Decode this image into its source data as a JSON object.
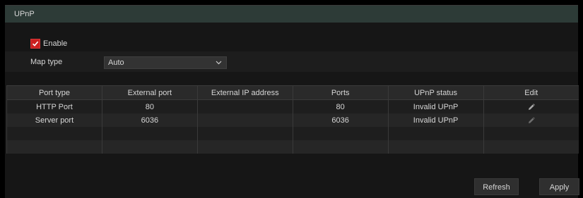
{
  "title": "UPnP",
  "enable": {
    "label": "Enable",
    "checked": true
  },
  "map_type": {
    "label": "Map type",
    "value": "Auto"
  },
  "table": {
    "columns": [
      "Port type",
      "External port",
      "External IP address",
      "Ports",
      "UPnP status",
      "Edit"
    ],
    "rows": [
      [
        "HTTP Port",
        "80",
        "",
        "80",
        "Invalid UPnP",
        "edit-icon"
      ],
      [
        "Server port",
        "6036",
        "",
        "6036",
        "Invalid UPnP",
        "edit-icon"
      ],
      [
        "",
        "",
        "",
        "",
        "",
        ""
      ],
      [
        "",
        "",
        "",
        "",
        "",
        ""
      ]
    ]
  },
  "buttons": {
    "refresh": "Refresh",
    "apply": "Apply"
  },
  "colors": {
    "title_bg": "#2d3b37",
    "checkbox": "#cc1f1f",
    "background": "#161616"
  }
}
